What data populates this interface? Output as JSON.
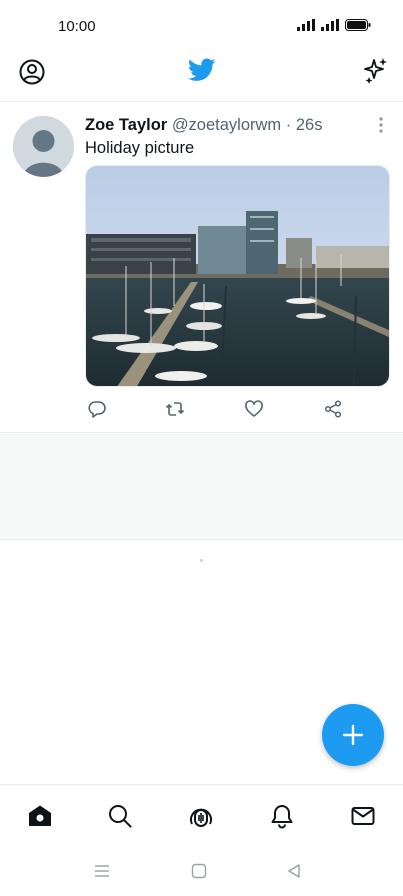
{
  "status_bar": {
    "time": "10:00"
  },
  "app_bar": {
    "profile_icon": "profile-icon",
    "logo_icon": "twitter-bird-icon",
    "sparkle_icon": "sparkle-icon",
    "accent_color": "#1d9bf0"
  },
  "tweet": {
    "name": "Zoe Taylor",
    "handle": "@zoetaylorwm",
    "separator": "·",
    "time": "26s",
    "text": "Holiday picture",
    "media": "harbour-photo",
    "actions": [
      "reply-icon",
      "retweet-icon",
      "like-icon",
      "share-icon"
    ]
  },
  "bottom_nav": {
    "items": [
      "home-icon",
      "search-icon",
      "spaces-icon",
      "notifications-icon",
      "messages-icon"
    ],
    "active": "home-icon"
  },
  "fab": {
    "icon": "plus-icon"
  },
  "system_nav": {
    "items": [
      "menu-icon",
      "home-square-icon",
      "back-icon"
    ]
  }
}
